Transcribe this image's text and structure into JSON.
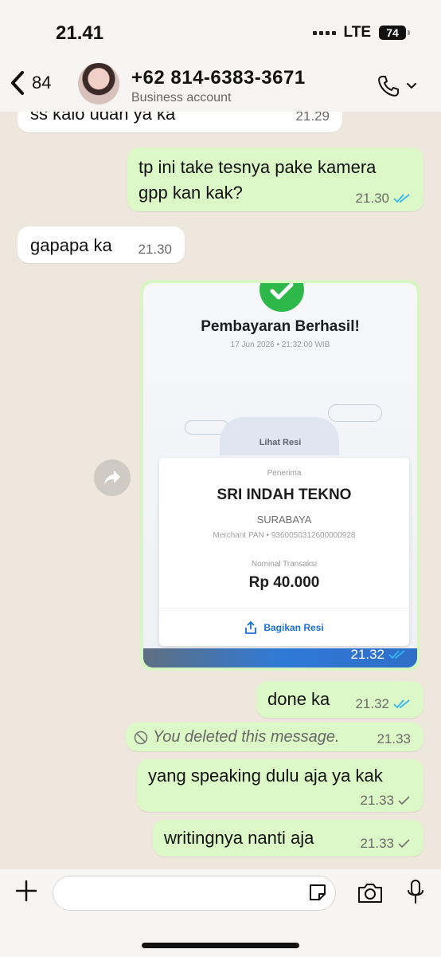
{
  "status": {
    "time": "21.41",
    "network": "LTE",
    "battery": "74"
  },
  "header": {
    "back_count": "84",
    "contact_name": "+62 814-6383-3671",
    "contact_subtitle": "Business account"
  },
  "messages": [
    {
      "text": "ss kalo udan ya ka",
      "time": "21.29"
    },
    {
      "text_line1": "tp ini take tesnya pake kamera",
      "text_line2": "gpp kan kak?",
      "time": "21.30"
    },
    {
      "text": "gapapa ka",
      "time": "21.30"
    },
    {
      "text": "done ka",
      "time": "21.32"
    },
    {
      "text": "You deleted this message.",
      "time": "21.33"
    },
    {
      "text": "yang speaking dulu aja ya kak",
      "time": "21.33"
    },
    {
      "text": "writingnya nanti aja",
      "time": "21.33"
    }
  ],
  "receipt": {
    "title": "Pembayaran Berhasil!",
    "datetime": "17 Jun 2026 • 21:32:00 WIB",
    "view_receipt": "Lihat Resi",
    "recipient_label": "Penerima",
    "recipient_name": "SRI INDAH TEKNO",
    "city": "SURABAYA",
    "merchant_pan": "Merchant PAN • 9360050312600000928",
    "amount_label": "Nominal Transaksi",
    "amount": "Rp 40.000",
    "share_label": "Bagikan Resi",
    "time": "21.32"
  },
  "colors": {
    "incoming_bubble": "#ffffff",
    "outgoing_bubble": "#dcf8c6",
    "read_tick": "#34b7f1",
    "success_green": "#2eb84a"
  },
  "icons": [
    "back-chevron-icon",
    "phone-icon",
    "chevron-down-icon",
    "forward-icon",
    "check-icon",
    "share-icon",
    "plus-icon",
    "sticker-icon",
    "camera-icon",
    "mic-icon",
    "deleted-icon"
  ]
}
